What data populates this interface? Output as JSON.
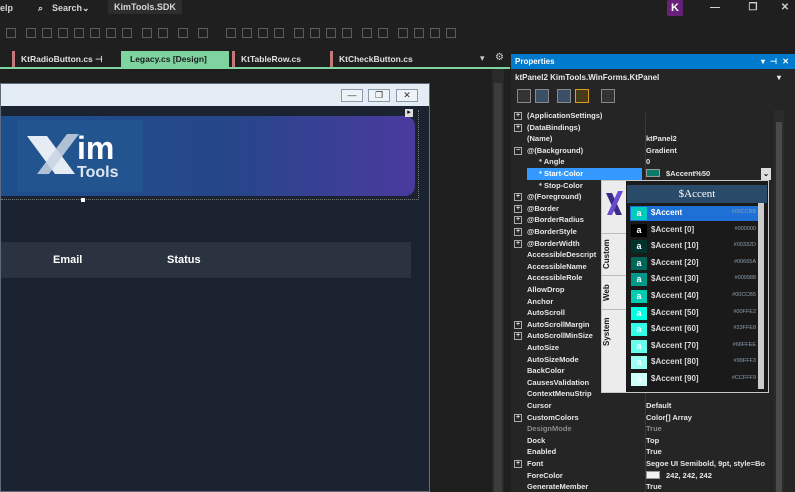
{
  "titlebar": {
    "menu_help": "elp",
    "search": "Search",
    "project": "KimTools.SDK",
    "avatar": "K",
    "minimize": "—",
    "restore": "❐",
    "close": "✕"
  },
  "tabs": [
    {
      "label": "KtRadioButton.cs",
      "pin": "⊣"
    },
    {
      "label": "Legacy.cs [Design]"
    },
    {
      "label": "KtTableRow.cs"
    },
    {
      "label": "KtCheckButton.cs"
    }
  ],
  "form": {
    "logo_im": "im",
    "logo_tools": "Tools",
    "grid_col_email": "Email",
    "grid_col_status": "Status"
  },
  "properties": {
    "title": "Properties",
    "object": "ktPanel2  KimTools.WinForms.KtPanel",
    "rows": [
      {
        "name": "(ApplicationSettings)",
        "value": "",
        "expander": "+"
      },
      {
        "name": "(DataBindings)",
        "value": "",
        "expander": "+"
      },
      {
        "name": "(Name)",
        "value": "ktPanel2"
      },
      {
        "name": "@(Background)",
        "value": "Gradient",
        "expander": "−"
      },
      {
        "name": "* Angle",
        "value": "0",
        "indent": true
      },
      {
        "name": "* Start-Color",
        "value": "$Accent%50",
        "indent": true,
        "selected": true,
        "swatch": "#0a7a6a"
      },
      {
        "name": "* Stop-Color",
        "value": "",
        "indent": true
      },
      {
        "name": "@(Foreground)",
        "value": "",
        "expander": "+"
      },
      {
        "name": "@Border",
        "value": "",
        "expander": "+"
      },
      {
        "name": "@BorderRadius",
        "value": "",
        "expander": "+"
      },
      {
        "name": "@BorderStyle",
        "value": "",
        "expander": "+"
      },
      {
        "name": "@BorderWidth",
        "value": "",
        "expander": "+"
      },
      {
        "name": "AccessibleDescript",
        "value": ""
      },
      {
        "name": "AccessibleName",
        "value": ""
      },
      {
        "name": "AccessibleRole",
        "value": ""
      },
      {
        "name": "AllowDrop",
        "value": ""
      },
      {
        "name": "Anchor",
        "value": ""
      },
      {
        "name": "AutoScroll",
        "value": ""
      },
      {
        "name": "AutoScrollMargin",
        "value": "",
        "expander": "+"
      },
      {
        "name": "AutoScrollMinSize",
        "value": "",
        "expander": "+"
      },
      {
        "name": "AutoSize",
        "value": ""
      },
      {
        "name": "AutoSizeMode",
        "value": ""
      },
      {
        "name": "BackColor",
        "value": ""
      },
      {
        "name": "CausesValidation",
        "value": ""
      },
      {
        "name": "ContextMenuStrip",
        "value": ""
      },
      {
        "name": "Cursor",
        "value": "Default"
      },
      {
        "name": "CustomColors",
        "value": "Color[] Array",
        "expander": "+"
      },
      {
        "name": "DesignMode",
        "value": "True",
        "dim": true
      },
      {
        "name": "Dock",
        "value": "Top"
      },
      {
        "name": "Enabled",
        "value": "True"
      },
      {
        "name": "Font",
        "value": "Segoe UI Semibold, 9pt, style=Bo",
        "expander": "+"
      },
      {
        "name": "ForeColor",
        "value": "242, 242, 242",
        "swatch": "#f2f2f2"
      },
      {
        "name": "GenerateMember",
        "value": "True"
      }
    ]
  },
  "picker": {
    "title": "$Accent",
    "side_tabs": [
      "Custom",
      "Web",
      "System"
    ],
    "swatches": [
      {
        "label": "$Accent",
        "hex": "#00CCBB",
        "color": "#00ccbb",
        "selected": true
      },
      {
        "label": "$Accent [0]",
        "hex": "#000000",
        "color": "#000000"
      },
      {
        "label": "$Accent [10]",
        "hex": "#00332D",
        "color": "#00332d"
      },
      {
        "label": "$Accent [20]",
        "hex": "#00665A",
        "color": "#00665a"
      },
      {
        "label": "$Accent [30]",
        "hex": "#009988",
        "color": "#009988"
      },
      {
        "label": "$Accent [40]",
        "hex": "#00CCB5",
        "color": "#00ccb5"
      },
      {
        "label": "$Accent [50]",
        "hex": "#00FFE2",
        "color": "#00ffe2"
      },
      {
        "label": "$Accent [60]",
        "hex": "#33FFE8",
        "color": "#33ffe8"
      },
      {
        "label": "$Accent [70]",
        "hex": "#66FFEE",
        "color": "#66ffee"
      },
      {
        "label": "$Accent [80]",
        "hex": "#99FFF3",
        "color": "#99fff3"
      },
      {
        "label": "$Accent [90]",
        "hex": "#CCFFF9",
        "color": "#ccfff9"
      }
    ],
    "chip_letter": "a"
  }
}
